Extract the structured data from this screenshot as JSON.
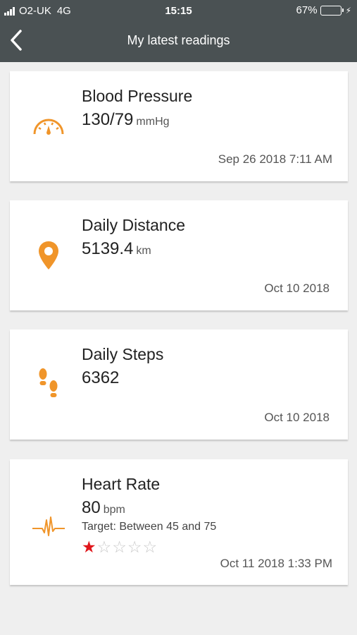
{
  "status_bar": {
    "carrier": "O2-UK",
    "network": "4G",
    "time": "15:15",
    "battery_percent": "67%",
    "battery_level": 0.67
  },
  "nav": {
    "title": "My latest readings",
    "back_icon": "chevron-left-icon"
  },
  "colors": {
    "accent": "#f0952a",
    "header": "#4a5153",
    "star_on": "#e0161b"
  },
  "readings": [
    {
      "title": "Blood Pressure",
      "value": "130/79",
      "unit": "mmHg",
      "date": "Sep 26 2018 7:11 AM",
      "icon": "gauge-icon"
    },
    {
      "title": "Daily Distance",
      "value": "5139.4",
      "unit": "km",
      "date": "Oct 10 2018",
      "icon": "location-pin-icon"
    },
    {
      "title": "Daily Steps",
      "value": "6362",
      "unit": "",
      "date": "Oct 10 2018",
      "icon": "footprints-icon"
    },
    {
      "title": "Heart Rate",
      "value": "80",
      "unit": "bpm",
      "target": "Target: Between 45 and 75",
      "rating": 1,
      "rating_max": 5,
      "date": "Oct 11 2018 1:33 PM",
      "icon": "heartbeat-icon"
    }
  ]
}
